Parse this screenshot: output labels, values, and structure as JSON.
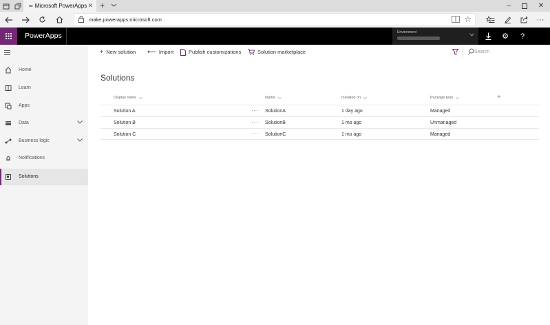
{
  "browser": {
    "tab_title": "Microsoft PowerApps",
    "tab_logo": "∞",
    "address": "make.powerapps.microsoft.com"
  },
  "app": {
    "title": "PowerApps",
    "environment_label": "Environment"
  },
  "sidebar": {
    "items": [
      {
        "label": "Home",
        "icon": "home-icon"
      },
      {
        "label": "Learn",
        "icon": "book-icon"
      },
      {
        "label": "Apps",
        "icon": "apps-icon"
      },
      {
        "label": "Data",
        "icon": "data-icon"
      },
      {
        "label": "Business logic",
        "icon": "flow-icon"
      },
      {
        "label": "Notifications",
        "icon": "bell-icon"
      },
      {
        "label": "Solutions",
        "icon": "solutions-icon"
      }
    ]
  },
  "commands": {
    "new_solution": "New solution",
    "import": "Import",
    "publish": "Publish customizations",
    "marketplace": "Solution marketplace",
    "search_placeholder": "Search"
  },
  "main": {
    "page_title": "Solutions",
    "columns": {
      "display_name": "Display name",
      "name": "Name",
      "installed_on": "Installed on",
      "package_type": "Package type"
    },
    "more_label": "···",
    "add_column_label": "+",
    "rows": [
      {
        "display_name": "Solution A",
        "name": "SolutionA",
        "installed_on": "1 day ago",
        "package_type": "Managed"
      },
      {
        "display_name": "Solution B",
        "name": "SolutionB",
        "installed_on": "1 mo ago",
        "package_type": "Unmanaged"
      },
      {
        "display_name": "Solution C",
        "name": "SolutionC",
        "installed_on": "1 mo ago",
        "package_type": "Managed"
      }
    ]
  },
  "colors": {
    "brand": "#742774",
    "header": "#000000",
    "sidebar": "#f4f4f4"
  }
}
